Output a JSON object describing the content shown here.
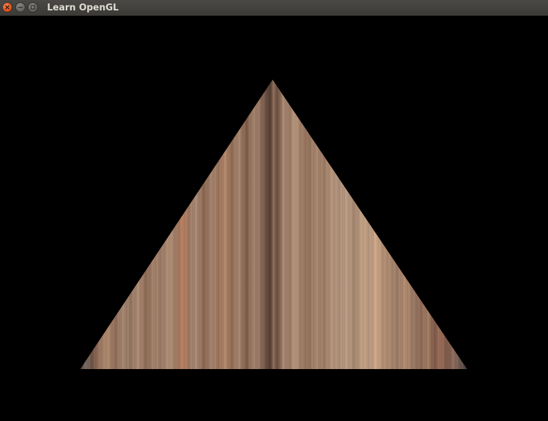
{
  "window": {
    "title": "Learn OpenGL",
    "controls": {
      "close": "close-icon",
      "minimize": "minimize-icon",
      "maximize": "maximize-icon"
    }
  },
  "canvas": {
    "clear_color": "#000000",
    "shape": "triangle",
    "texture": "wood-grain-stripes",
    "texture_colors": [
      "#a17c63",
      "#8f6a52",
      "#b8957a",
      "#7a5641",
      "#c4a183",
      "#6b4c3b",
      "#9e7f68",
      "#b58566",
      "#5a4336"
    ]
  }
}
